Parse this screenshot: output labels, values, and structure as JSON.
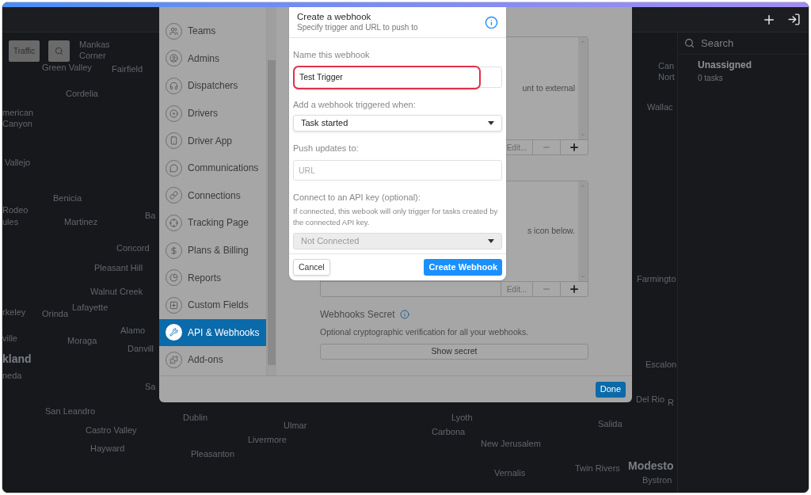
{
  "map": {
    "buttons": [
      {
        "label": "Traffic"
      }
    ],
    "labels": [
      {
        "text": "Mankas Corner",
        "kind": "town"
      },
      {
        "text": "Green Valley",
        "kind": "town"
      },
      {
        "text": "Fairfield",
        "kind": "town"
      },
      {
        "text": "Can Nort",
        "kind": "town"
      },
      {
        "text": "Cordelia",
        "kind": "town"
      },
      {
        "text": "Wallac",
        "kind": "town"
      },
      {
        "text": "merican Canyon",
        "kind": "town"
      },
      {
        "text": "Vallejo",
        "kind": "town"
      },
      {
        "text": "Benicia",
        "kind": "town"
      },
      {
        "text": "Rodeo",
        "kind": "town"
      },
      {
        "text": "ules",
        "kind": "town"
      },
      {
        "text": "Martinez",
        "kind": "town"
      },
      {
        "text": "Ba",
        "kind": "town"
      },
      {
        "text": "Concord",
        "kind": "town"
      },
      {
        "text": "Pleasant Hill",
        "kind": "town"
      },
      {
        "text": "Farmingto",
        "kind": "town"
      },
      {
        "text": "Walnut Creek",
        "kind": "town"
      },
      {
        "text": "rkeley",
        "kind": "town"
      },
      {
        "text": "Orinda",
        "kind": "town"
      },
      {
        "text": "Lafayette",
        "kind": "town"
      },
      {
        "text": "ville",
        "kind": "town"
      },
      {
        "text": "Moraga",
        "kind": "town"
      },
      {
        "text": "Alamo",
        "kind": "town"
      },
      {
        "text": "Danvill",
        "kind": "town"
      },
      {
        "text": "kland",
        "kind": "city"
      },
      {
        "text": "Escalon",
        "kind": "town"
      },
      {
        "text": "neda",
        "kind": "town"
      },
      {
        "text": "Sa",
        "kind": "town"
      },
      {
        "text": "Del Rio",
        "kind": "town"
      },
      {
        "text": "R",
        "kind": "town"
      },
      {
        "text": "San Leandro",
        "kind": "town"
      },
      {
        "text": "Dublin",
        "kind": "town"
      },
      {
        "text": "Lyoth",
        "kind": "town"
      },
      {
        "text": "Salida",
        "kind": "town"
      },
      {
        "text": "Ulmar",
        "kind": "town"
      },
      {
        "text": "Castro Valley",
        "kind": "town"
      },
      {
        "text": "Carbona",
        "kind": "town"
      },
      {
        "text": "Livermore",
        "kind": "town"
      },
      {
        "text": "New Jerusalem",
        "kind": "town"
      },
      {
        "text": "Hayward",
        "kind": "town"
      },
      {
        "text": "Pleasanton",
        "kind": "town"
      },
      {
        "text": "Vernalis",
        "kind": "town"
      },
      {
        "text": "Twin Rivers",
        "kind": "town"
      },
      {
        "text": "Modesto",
        "kind": "city"
      },
      {
        "text": "Bystron",
        "kind": "town"
      }
    ]
  },
  "task_panel": {
    "search_placeholder": "Search",
    "groups": [
      {
        "title": "Unassigned",
        "count": "0 tasks"
      }
    ]
  },
  "settings": {
    "nav": [
      {
        "label": "Teams",
        "selected": false
      },
      {
        "label": "Admins",
        "selected": false
      },
      {
        "label": "Dispatchers",
        "selected": false
      },
      {
        "label": "Drivers",
        "selected": false
      },
      {
        "label": "Driver App",
        "selected": false
      },
      {
        "label": "Communications",
        "selected": false
      },
      {
        "label": "Connections",
        "selected": false
      },
      {
        "label": "Tracking Page",
        "selected": false
      },
      {
        "label": "Plans & Billing",
        "selected": false
      },
      {
        "label": "Reports",
        "selected": false
      },
      {
        "label": "Custom Fields",
        "selected": false
      },
      {
        "label": "API & Webhooks",
        "selected": true
      },
      {
        "label": "Add-ons",
        "selected": false
      }
    ],
    "lists": [
      {
        "text": "unt to external",
        "edit": "Edit..."
      },
      {
        "text": "s icon below.",
        "edit": "Edit..."
      }
    ],
    "secret": {
      "title": "Webhooks Secret",
      "description": "Optional cryptographic verification for all your webhooks.",
      "button": "Show secret"
    },
    "done": "Done"
  },
  "modal": {
    "title": "Create a webhook",
    "subtitle": "Specify trigger and URL to push to",
    "name_label": "Name this webhook",
    "name_value": "Test Trigger",
    "name_highlighted": true,
    "trigger_label": "Add a webhook triggered when:",
    "trigger_value": "Task started",
    "url_label": "Push updates to:",
    "url_placeholder": "URL",
    "api_label": "Connect to an API key (optional):",
    "api_help": "If connected, this webook will only trigger for tasks created by the connected API key.",
    "api_value": "Not Connected",
    "api_disabled": true,
    "cancel": "Cancel",
    "submit": "Create Webhook"
  }
}
